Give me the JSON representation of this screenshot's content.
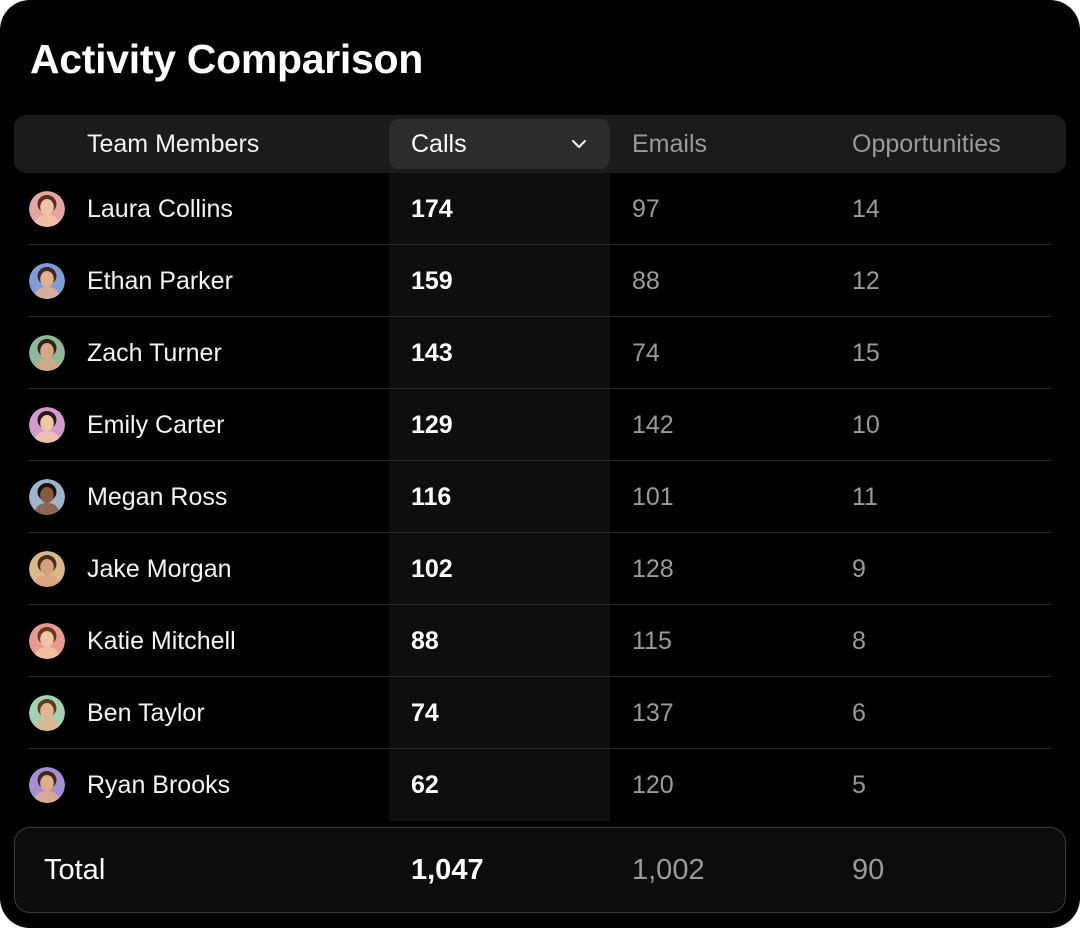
{
  "title": "Activity Comparison",
  "header": {
    "members": "Team Members",
    "calls": "Calls",
    "emails": "Emails",
    "opportunities": "Opportunities"
  },
  "rows": [
    {
      "name": "Laura Collins",
      "calls": "174",
      "emails": "97",
      "opportunities": "14",
      "avatar": {
        "bg": "#e3a7a0",
        "skin": "#f1c3a4",
        "hair": "#5b2e22"
      }
    },
    {
      "name": "Ethan Parker",
      "calls": "159",
      "emails": "88",
      "opportunities": "12",
      "avatar": {
        "bg": "#7f9ed8",
        "skin": "#e2b08e",
        "hair": "#3d2a1d"
      }
    },
    {
      "name": "Zach Turner",
      "calls": "143",
      "emails": "74",
      "opportunities": "15",
      "avatar": {
        "bg": "#8fb79a",
        "skin": "#d9a785",
        "hair": "#2e2219"
      }
    },
    {
      "name": "Emily Carter",
      "calls": "129",
      "emails": "142",
      "opportunities": "10",
      "avatar": {
        "bg": "#d39ad0",
        "skin": "#f0c6a8",
        "hair": "#2a1b14"
      }
    },
    {
      "name": "Megan Ross",
      "calls": "116",
      "emails": "101",
      "opportunities": "11",
      "avatar": {
        "bg": "#9db4c9",
        "skin": "#8a5a3f",
        "hair": "#1a110c"
      }
    },
    {
      "name": "Jake Morgan",
      "calls": "102",
      "emails": "128",
      "opportunities": "9",
      "avatar": {
        "bg": "#d9b98a",
        "skin": "#d9a07c",
        "hair": "#4a2f1e"
      }
    },
    {
      "name": "Katie Mitchell",
      "calls": "88",
      "emails": "115",
      "opportunities": "8",
      "avatar": {
        "bg": "#e89a90",
        "skin": "#f2c4a6",
        "hair": "#6b3a25"
      }
    },
    {
      "name": "Ben Taylor",
      "calls": "74",
      "emails": "137",
      "opportunities": "6",
      "avatar": {
        "bg": "#a4d1b0",
        "skin": "#e3b48f",
        "hair": "#5a3b24"
      }
    },
    {
      "name": "Ryan Brooks",
      "calls": "62",
      "emails": "120",
      "opportunities": "5",
      "avatar": {
        "bg": "#a48fd0",
        "skin": "#e0ad8a",
        "hair": "#3b2a20"
      }
    }
  ],
  "total": {
    "label": "Total",
    "calls": "1,047",
    "emails": "1,002",
    "opportunities": "90"
  },
  "icons": {
    "sort_dropdown": "chevron-down-icon"
  },
  "colors": {
    "background": "#000000",
    "header_bar": "#1b1b1b",
    "selected_header": "#2c2c2c",
    "muted_text": "#9a9a9a"
  }
}
